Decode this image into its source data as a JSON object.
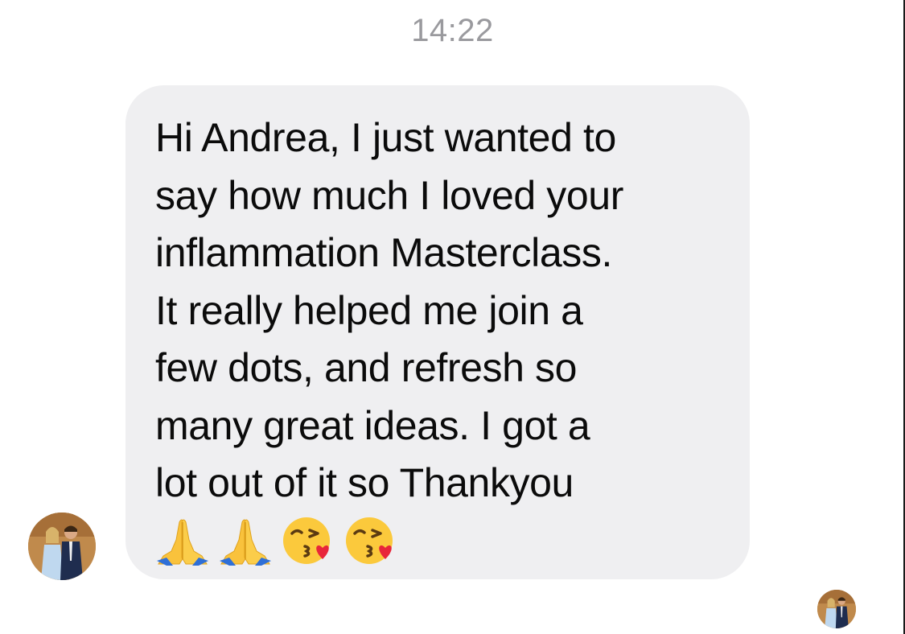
{
  "conversation": {
    "timestamp": "14:22"
  },
  "message": {
    "text": "Hi Andrea, I just wanted to\nsay how much I loved your\ninflammation Masterclass.\nIt really helped me join a\nfew dots, and refresh so\nmany great ideas. I got a\nlot out of it so Thankyou",
    "emojis": [
      "folded-hands-icon",
      "folded-hands-icon",
      "face-blowing-kiss-icon",
      "face-blowing-kiss-icon"
    ]
  },
  "colors": {
    "bubble_background": "#efeff1",
    "timestamp_text": "#9a9a9e",
    "message_text": "#0b0b0b"
  },
  "icons": {
    "sender_avatar": "avatar-photo",
    "read_receipt": "avatar-photo"
  }
}
